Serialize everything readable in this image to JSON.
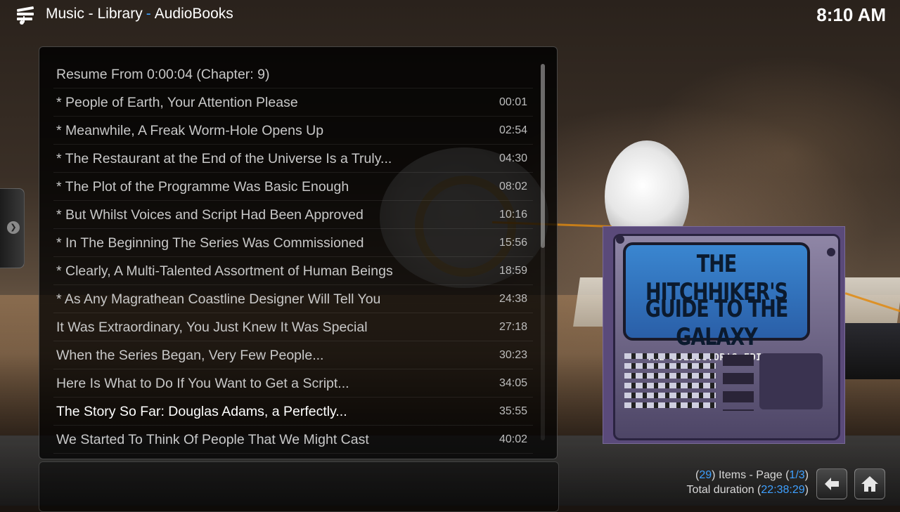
{
  "header": {
    "breadcrumb_part1": "Music - Library",
    "breadcrumb_sep": "-",
    "breadcrumb_part2": "AudioBooks",
    "clock": "8:10 AM"
  },
  "list": {
    "items": [
      {
        "title": "Resume From 0:00:04 (Chapter: 9)",
        "time": ""
      },
      {
        "title": "* People of Earth, Your Attention Please",
        "time": "00:01"
      },
      {
        "title": "* Meanwhile, A Freak Worm-Hole Opens Up",
        "time": "02:54"
      },
      {
        "title": "* The Restaurant at the End of the Universe Is a Truly...",
        "time": "04:30"
      },
      {
        "title": "* The Plot of the Programme Was Basic Enough",
        "time": "08:02"
      },
      {
        "title": "* But Whilst Voices and Script Had Been Approved",
        "time": "10:16"
      },
      {
        "title": "* In The Beginning The Series Was Commissioned",
        "time": "15:56"
      },
      {
        "title": "* Clearly, A Multi-Talented Assortment of Human Beings",
        "time": "18:59"
      },
      {
        "title": "* As Any Magrathean Coastline Designer Will Tell You",
        "time": "24:38"
      },
      {
        "title": "It Was Extraordinary, You Just Knew It Was Special",
        "time": "27:18"
      },
      {
        "title": "When the Series Began, Very Few People...",
        "time": "30:23"
      },
      {
        "title": "Here Is What to Do If You Want to Get a Script...",
        "time": "34:05"
      },
      {
        "title": "The Story So Far: Douglas Adams, a Perfectly...",
        "time": "35:55"
      },
      {
        "title": "We Started To Think Of People That We Might Cast",
        "time": "40:02"
      }
    ],
    "selected_index": 12
  },
  "cover": {
    "line1": "THE HITCHHIKER'S",
    "line2": "GUIDE TO THE GALAXY",
    "line3": "THE COLLECTOR'S EDITION"
  },
  "footer": {
    "items_open": "(",
    "items_count": "29",
    "items_text": ") Items - Page (",
    "page": "1/3",
    "items_close": ")",
    "duration_label": "Total duration (",
    "duration": "22:38:29",
    "duration_close": ")"
  },
  "icons": {
    "app": "music-library-icon",
    "back": "back-arrow-icon",
    "home": "home-icon"
  },
  "colors": {
    "accent": "#3ea0ff",
    "selected_text": "#ffffff"
  }
}
